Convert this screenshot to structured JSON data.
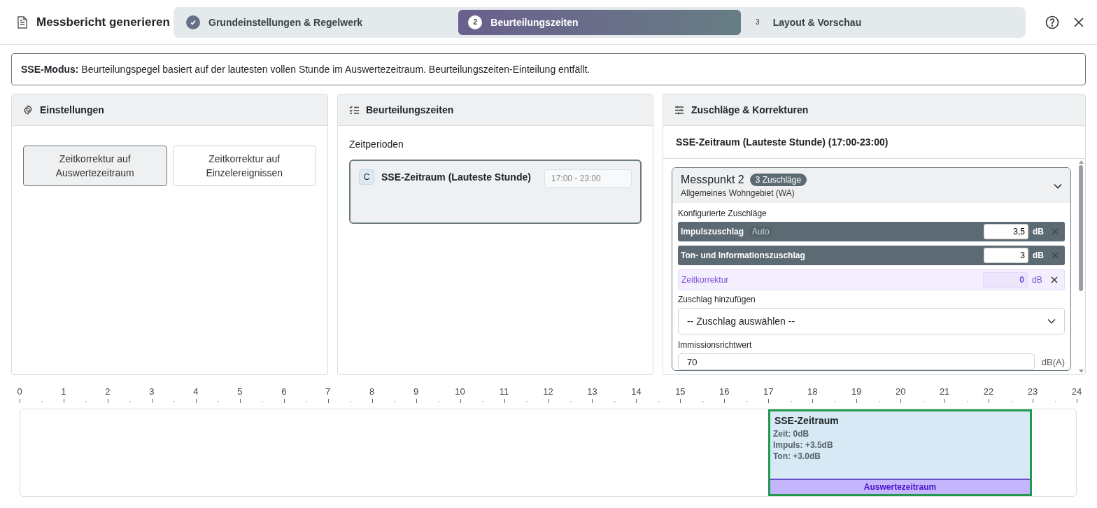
{
  "header": {
    "title": "Messbericht generieren"
  },
  "steps": [
    {
      "label": "Grundeinstellungen & Regelwerk",
      "completed": true,
      "selected": false
    },
    {
      "number": "2",
      "label": "Beurteilungszeiten",
      "completed": false,
      "selected": true
    },
    {
      "number": "3",
      "label": "Layout & Vorschau",
      "completed": false,
      "selected": false
    }
  ],
  "notice": {
    "text": "**SSE-Modus:** Beurteilungspegel basiert auf der lautesten vollen Stunde im Auswertezeitraum. Beurteilungszeiten-Einteilung entfällt."
  },
  "settings": {
    "title": "Einstellungen",
    "options": [
      {
        "label": "Zeitkorrektur auf Auswertezeitraum",
        "selected": true
      },
      {
        "label": "Zeitkorrektur auf Einzelereignissen",
        "selected": false
      }
    ]
  },
  "periods": {
    "title": "Beurteilungszeiten",
    "label": "Zeitperioden",
    "items": [
      {
        "badge": "C",
        "name": "SSE-Zeitraum (Lauteste Stunde)",
        "time": "17:00 - 23:00",
        "selected": true
      }
    ]
  },
  "penalties": {
    "title": "Zuschläge & Korrekturen",
    "subtitle": "SSE-Zeitraum (Lauteste Stunde) (17:00-23:00)",
    "point": {
      "name": "Messpunkt 2",
      "count_badge": "3 Zuschläge",
      "area": "Allgemeines Wohngebiet (WA)",
      "expanded": true,
      "configured_label": "Konfigurierte Zuschläge",
      "rows": [
        {
          "kind": "penalty",
          "name": "Impulszuschlag",
          "tag": "Auto",
          "value": "3,5",
          "unit": "dB"
        },
        {
          "kind": "penalty",
          "name": "Ton- und Informationszuschlag",
          "value": "3",
          "unit": "dB"
        },
        {
          "kind": "correction",
          "name": "Zeitkorrektur",
          "value": "0",
          "unit": "dB"
        }
      ],
      "add_label": "Zuschlag hinzufügen",
      "add_select": "-- Zuschlag auswählen --",
      "limit_label": "Immissionsrichtwert",
      "limit_value": "70",
      "limit_unit": "dB(A)"
    }
  },
  "timeline": {
    "ticks": [
      "0",
      "1",
      "2",
      "3",
      "4",
      "5",
      "6",
      "7",
      "8",
      "9",
      "10",
      "11",
      "12",
      "13",
      "14",
      "15",
      "16",
      "17",
      "18",
      "19",
      "20",
      "21",
      "22",
      "23",
      "24"
    ],
    "block": {
      "title": "SSE-Zeitraum",
      "lines": [
        "Zeit: 0dB",
        "Impuls: +3.5dB",
        "Ton: +3.0dB"
      ],
      "footer": "Auswertezeitraum"
    }
  }
}
